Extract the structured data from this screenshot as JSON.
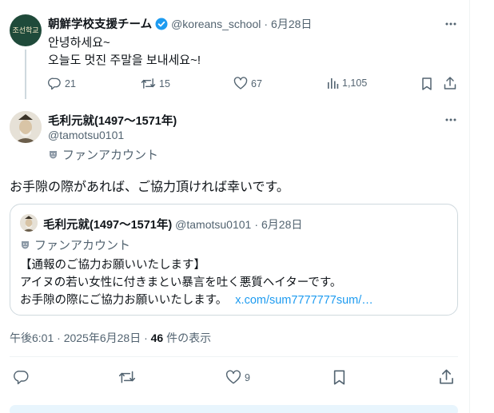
{
  "tweet1": {
    "author_name": "朝鮮学校支援チーム",
    "handle": "@koreans_school",
    "sep": "·",
    "date": "6月28日",
    "avatar_text": "조선학교",
    "line1": "안녕하세요~",
    "line2": "오늘도 멋진 주말을 보내세요~!",
    "stats": {
      "replies": "21",
      "reposts": "15",
      "likes": "67",
      "views": "1,105"
    }
  },
  "tweet2": {
    "author_name": "毛利元就(1497～1571年)",
    "handle": "@tamotsu0101",
    "fan_label": "ファンアカウント",
    "body": "お手隙の際があれば、ご協力頂ければ幸いです。",
    "quote": {
      "author_name": "毛利元就(1497～1571年)",
      "handle": "@tamotsu0101",
      "sep": "·",
      "date": "6月28日",
      "fan_label": "ファンアカウント",
      "line1": "【通報のご協力お願いいたします】",
      "line2": "アイヌの若い女性に付きまとい暴言を吐く悪質ヘイターです。",
      "line3_text": "お手隙の際にご協力お願いいたします。",
      "line3_link": "x.com/sum7777777sum/…"
    },
    "meta": {
      "time": "午後6:01 · 2025年6月28日 · ",
      "views_count": "46",
      "views_label": " 件の表示"
    },
    "stats": {
      "likes": "9"
    }
  },
  "colors": {
    "link": "#1d9bf0",
    "muted": "#536471",
    "verified": "#1d9bf0",
    "border": "#cfd9de"
  }
}
